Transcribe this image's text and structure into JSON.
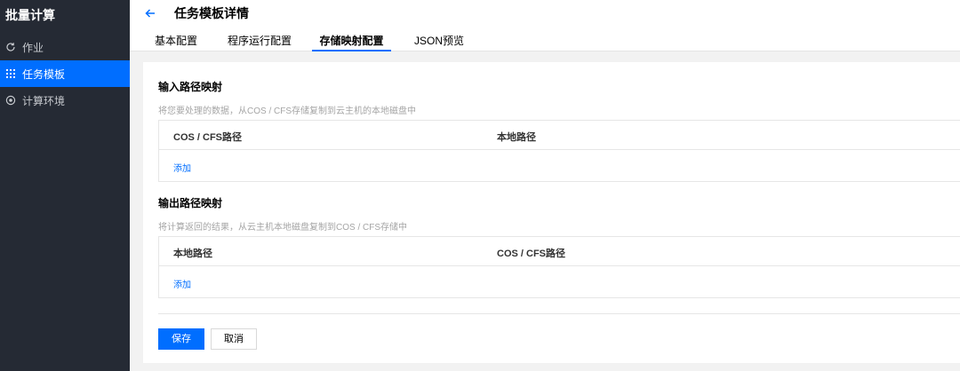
{
  "sidebar": {
    "brand": "批量计算",
    "items": [
      {
        "label": "作业",
        "icon": "refresh-icon",
        "active": false
      },
      {
        "label": "任务模板",
        "icon": "grid-icon",
        "active": true
      },
      {
        "label": "计算环境",
        "icon": "target-icon",
        "active": false
      }
    ]
  },
  "header": {
    "title": "任务模板详情",
    "tabs": [
      {
        "label": "基本配置",
        "active": false
      },
      {
        "label": "程序运行配置",
        "active": false
      },
      {
        "label": "存储映射配置",
        "active": true
      },
      {
        "label": "JSON预览",
        "active": false
      }
    ]
  },
  "input_mapping": {
    "title": "输入路径映射",
    "description": "将您要处理的数据，从COS / CFS存储复制到云主机的本地磁盘中",
    "columns": [
      "COS / CFS路径",
      "本地路径"
    ],
    "add_label": "添加"
  },
  "output_mapping": {
    "title": "输出路径映射",
    "description": "将计算返回的结果，从云主机本地磁盘复制到COS / CFS存储中",
    "columns": [
      "本地路径",
      "COS / CFS路径"
    ],
    "add_label": "添加"
  },
  "actions": {
    "save_label": "保存",
    "cancel_label": "取消"
  },
  "colors": {
    "accent": "#006eff",
    "sidebar_bg": "#252a34"
  }
}
